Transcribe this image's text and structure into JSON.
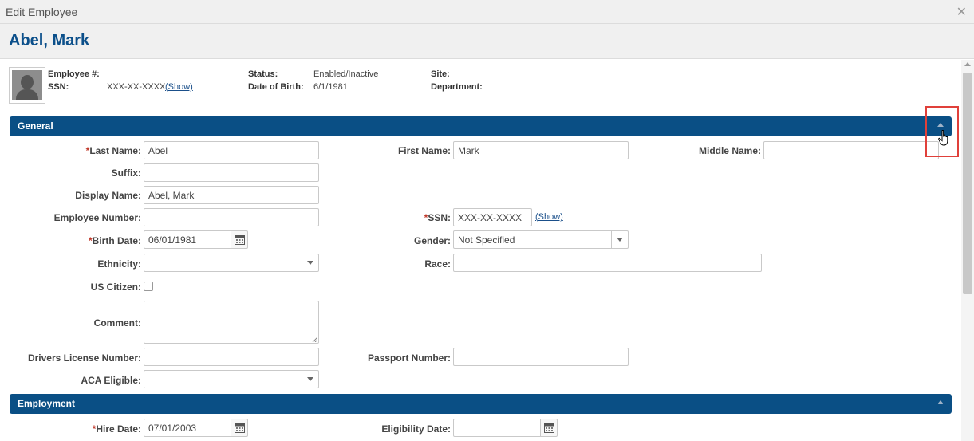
{
  "window": {
    "title": "Edit Employee",
    "close_icon": "close-icon"
  },
  "employee_name": "Abel, Mark",
  "summary": {
    "employee_num_label": "Employee #:",
    "employee_num_value": "",
    "ssn_label": "SSN:",
    "ssn_value": "XXX-XX-XXXX",
    "ssn_show": "(Show)",
    "status_label": "Status:",
    "status_value": "Enabled/Inactive",
    "dob_label": "Date of Birth:",
    "dob_value": "6/1/1981",
    "site_label": "Site:",
    "site_value": "",
    "department_label": "Department:",
    "department_value": ""
  },
  "sections": {
    "general": "General",
    "employment": "Employment"
  },
  "general": {
    "last_name": {
      "required": "*",
      "label": "Last Name:",
      "value": "Abel"
    },
    "first_name": {
      "label": "First Name:",
      "value": "Mark"
    },
    "middle_name": {
      "label": "Middle Name:",
      "value": ""
    },
    "suffix": {
      "label": "Suffix:",
      "value": ""
    },
    "display_name": {
      "label": "Display Name:",
      "value": "Abel, Mark"
    },
    "employee_number": {
      "label": "Employee Number:",
      "value": ""
    },
    "ssn": {
      "required": "*",
      "label": "SSN:",
      "value": "XXX-XX-XXXX",
      "show": "(Show)"
    },
    "birth_date": {
      "required": "*",
      "label": "Birth Date:",
      "value": "06/01/1981"
    },
    "gender": {
      "label": "Gender:",
      "value": "Not Specified"
    },
    "ethnicity": {
      "label": "Ethnicity:",
      "value": ""
    },
    "race": {
      "label": "Race:",
      "value": ""
    },
    "us_citizen": {
      "label": "US Citizen:",
      "checked": false
    },
    "comment": {
      "label": "Comment:",
      "value": ""
    },
    "drivers_license": {
      "label": "Drivers License Number:",
      "value": ""
    },
    "passport": {
      "label": "Passport Number:",
      "value": ""
    },
    "aca_eligible": {
      "label": "ACA Eligible:",
      "value": ""
    }
  },
  "employment": {
    "hire_date": {
      "required": "*",
      "label": "Hire Date:",
      "value": "07/01/2003"
    },
    "eligibility_date": {
      "label": "Eligibility Date:",
      "value": ""
    }
  },
  "colors": {
    "header_blue": "#0a4f85",
    "name_blue": "#0b4f8a",
    "required_red": "#c0392b",
    "highlight_red": "#e0403a"
  }
}
